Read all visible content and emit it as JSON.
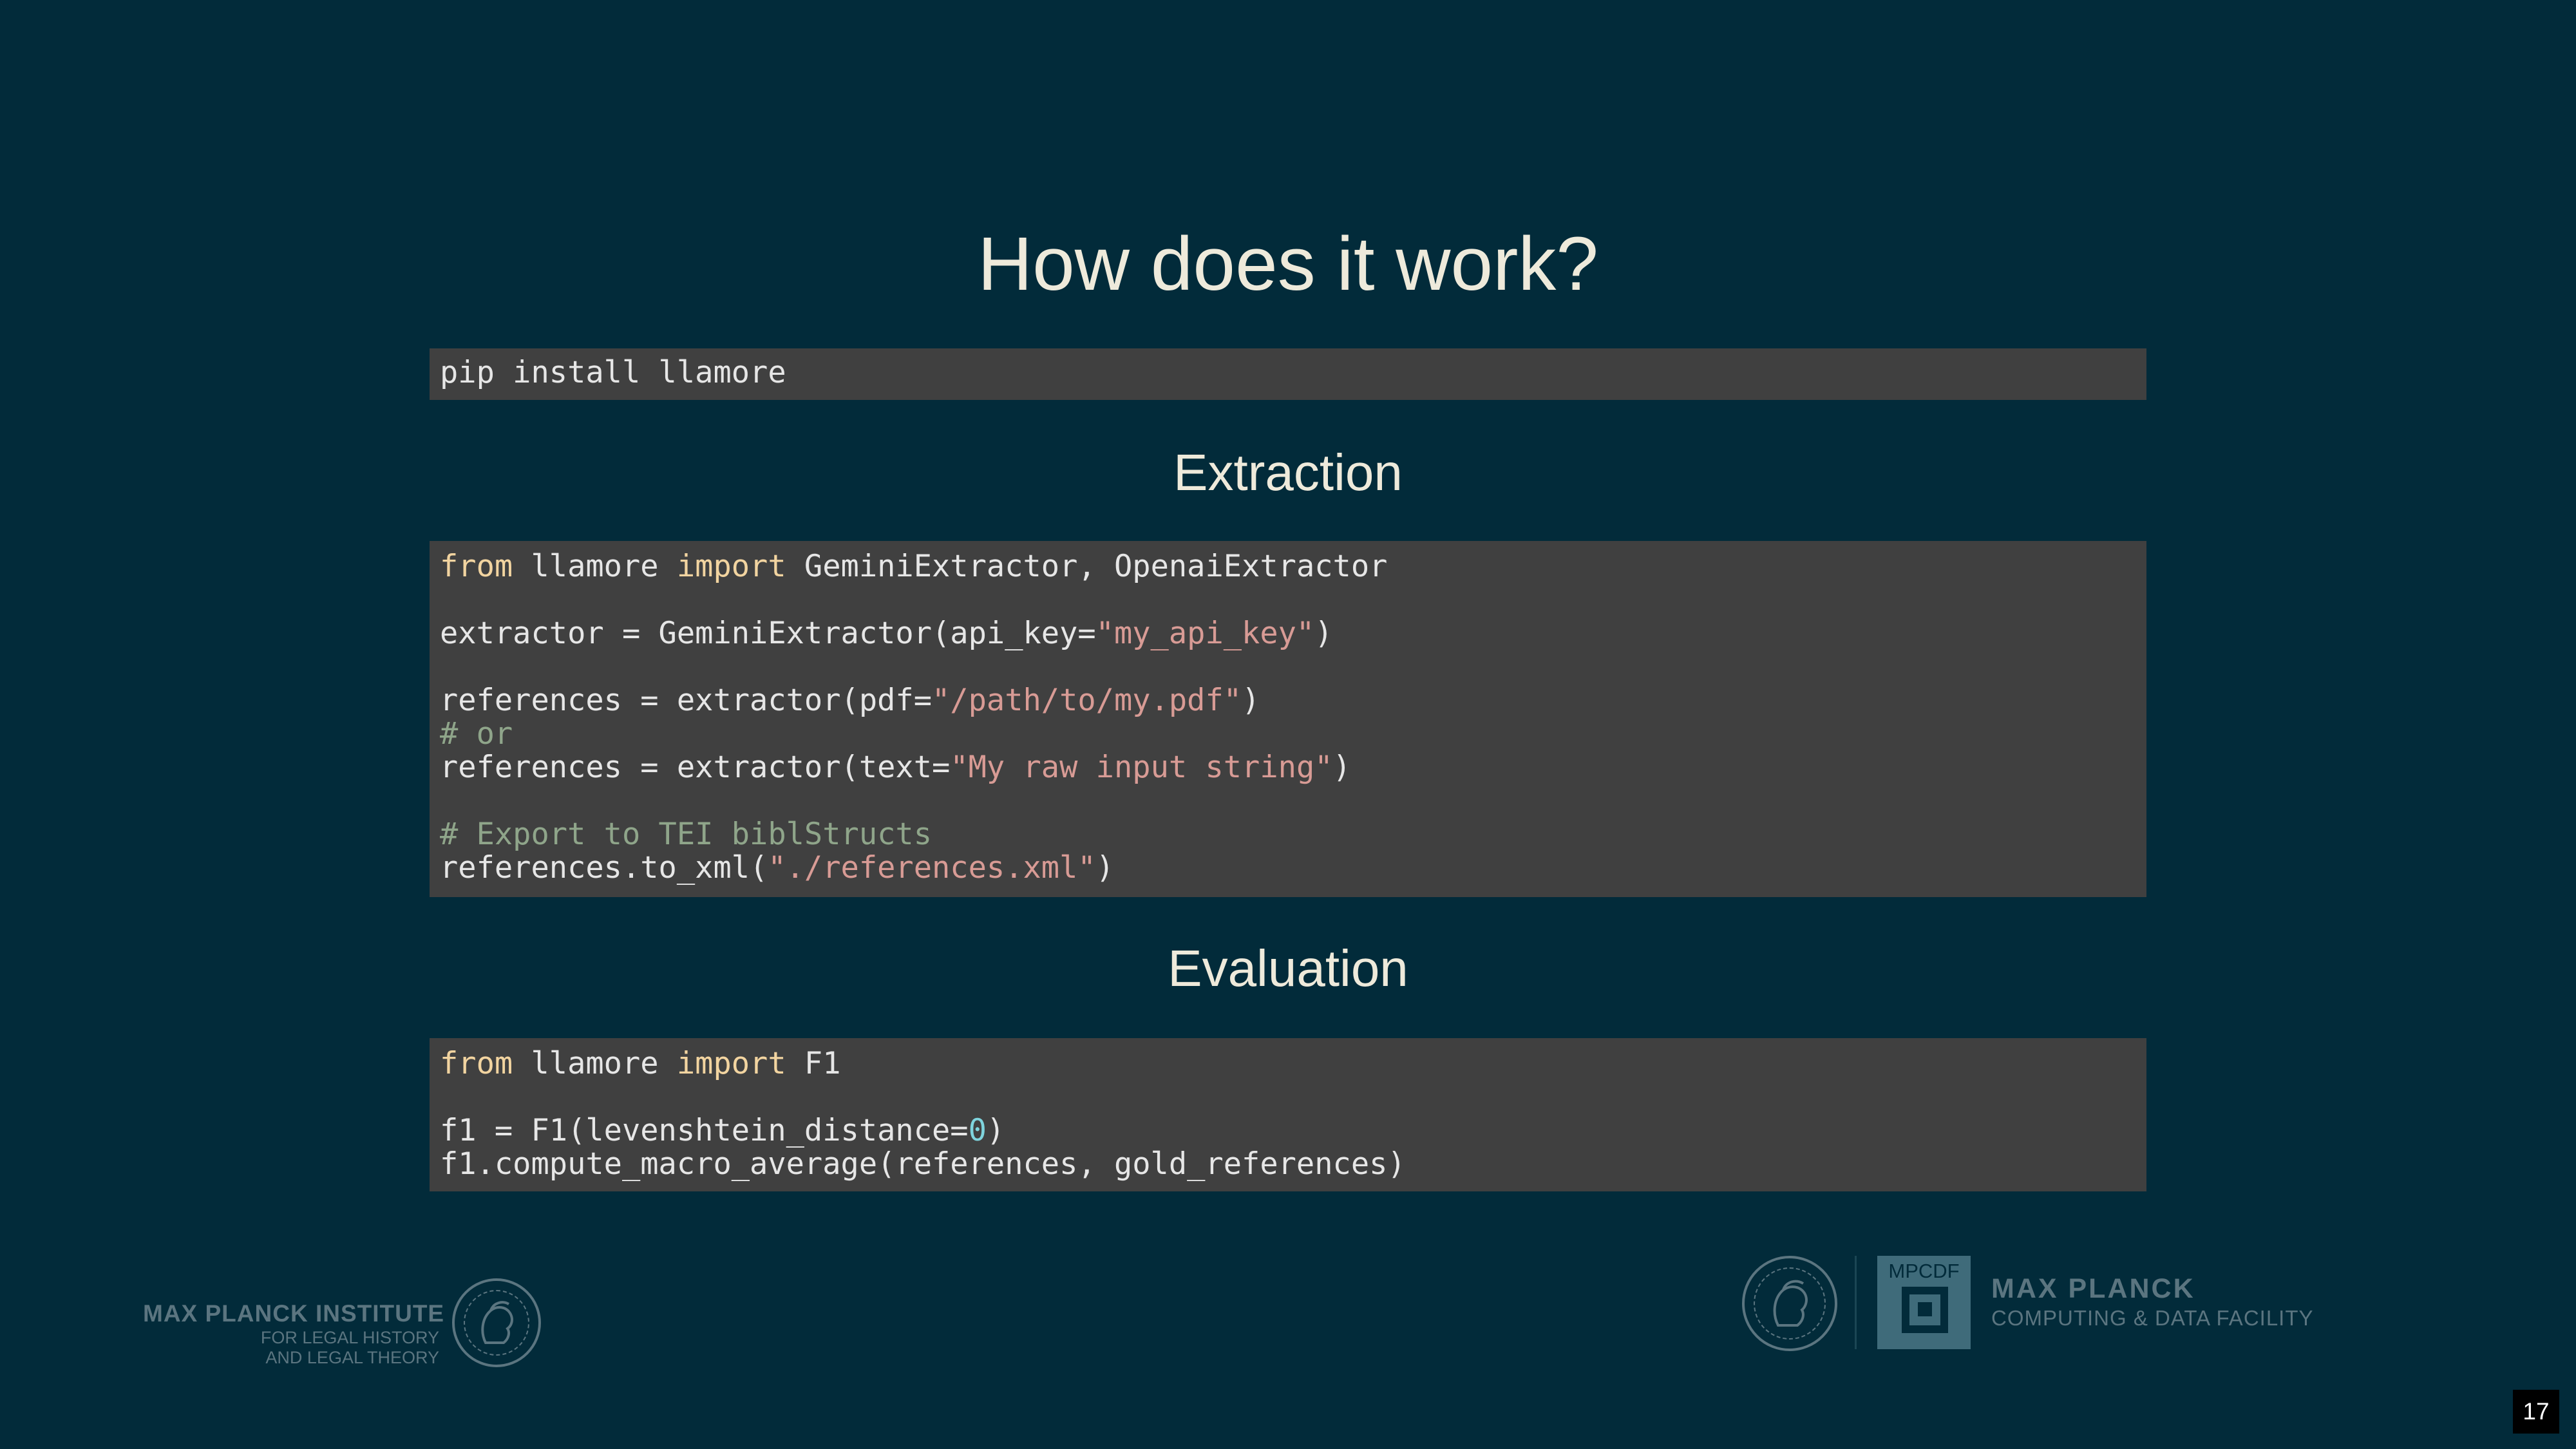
{
  "slide": {
    "title": "How does it work?",
    "install": {
      "command": "pip install llamore"
    },
    "extraction": {
      "heading": "Extraction",
      "lines": [
        {
          "parts": [
            {
              "t": "from",
              "c": "kw"
            },
            {
              "t": " llamore ",
              "c": ""
            },
            {
              "t": "import",
              "c": "kw"
            },
            {
              "t": " GeminiExtractor, OpenaiExtractor",
              "c": ""
            }
          ]
        },
        {
          "parts": []
        },
        {
          "parts": [
            {
              "t": "extractor = GeminiExtractor(api_key=",
              "c": ""
            },
            {
              "t": "\"my_api_key\"",
              "c": "str"
            },
            {
              "t": ")",
              "c": ""
            }
          ]
        },
        {
          "parts": []
        },
        {
          "parts": [
            {
              "t": "references = extractor(pdf=",
              "c": ""
            },
            {
              "t": "\"/path/to/my.pdf\"",
              "c": "str"
            },
            {
              "t": ")",
              "c": ""
            }
          ]
        },
        {
          "parts": [
            {
              "t": "# or",
              "c": "cmt"
            }
          ]
        },
        {
          "parts": [
            {
              "t": "references = extractor(text=",
              "c": ""
            },
            {
              "t": "\"My raw input string\"",
              "c": "str"
            },
            {
              "t": ")",
              "c": ""
            }
          ]
        },
        {
          "parts": []
        },
        {
          "parts": [
            {
              "t": "# Export to TEI biblStructs",
              "c": "cmt"
            }
          ]
        },
        {
          "parts": [
            {
              "t": "references.to_xml(",
              "c": ""
            },
            {
              "t": "\"./references.xml\"",
              "c": "str"
            },
            {
              "t": ")",
              "c": ""
            }
          ]
        }
      ]
    },
    "evaluation": {
      "heading": "Evaluation",
      "lines": [
        {
          "parts": [
            {
              "t": "from",
              "c": "kw"
            },
            {
              "t": " llamore ",
              "c": ""
            },
            {
              "t": "import",
              "c": "kw"
            },
            {
              "t": " F1",
              "c": ""
            }
          ]
        },
        {
          "parts": []
        },
        {
          "parts": [
            {
              "t": "f1 = F1(levenshtein_distance=",
              "c": ""
            },
            {
              "t": "0",
              "c": "num"
            },
            {
              "t": ")",
              "c": ""
            }
          ]
        },
        {
          "parts": [
            {
              "t": "f1.compute_macro_average(references, gold_references)",
              "c": ""
            }
          ]
        }
      ]
    }
  },
  "footer": {
    "left_logo": {
      "name": "MAX PLANCK INSTITUTE",
      "sub1": "FOR LEGAL HISTORY",
      "sub2": "AND LEGAL THEORY",
      "icon": "minerva-seal-icon"
    },
    "right_logo": {
      "icon": "minerva-seal-icon",
      "box_label": "MPCDF",
      "name": "MAX PLANCK",
      "sub": "COMPUTING & DATA FACILITY"
    }
  },
  "page_number": "17",
  "colors": {
    "background": "#022b3a",
    "code_background": "#404040",
    "keyword": "#f2d4a0",
    "string": "#d89b95",
    "comment": "#8fa58a",
    "number": "#7fd4dd"
  }
}
